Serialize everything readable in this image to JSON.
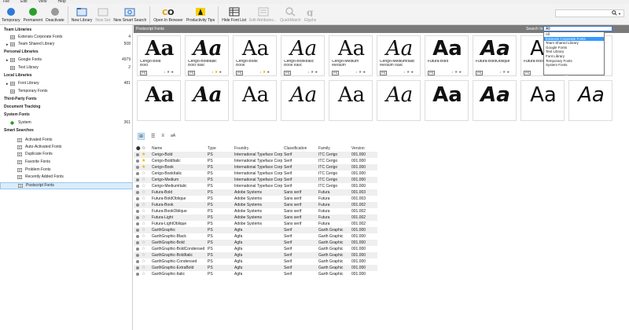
{
  "menu": [
    "File",
    "Edit",
    "View",
    "Help"
  ],
  "toolbar": {
    "buttons": [
      {
        "label": "Temporary",
        "icon": "temporary-icon",
        "color": "#2f7ad9",
        "enabled": true
      },
      {
        "label": "Permanent",
        "icon": "permanent-icon",
        "color": "#2aa02a",
        "enabled": true
      },
      {
        "label": "Deactivate",
        "icon": "deactivate-icon",
        "color": "#9a9a9a",
        "enabled": true
      },
      {
        "label": "New Library",
        "icon": "new-library-icon",
        "color": "#2f6fbf",
        "enabled": true
      },
      {
        "label": "New Set",
        "icon": "new-set-icon",
        "color": "#bbbbbb",
        "enabled": false
      },
      {
        "label": "New Smart Search",
        "icon": "new-smart-search-icon",
        "color": "#3070c0",
        "enabled": true
      },
      {
        "label": "Open In Browser",
        "icon": "open-in-browser-icon",
        "color": "#222222",
        "enabled": true
      },
      {
        "label": "Productivity Tips",
        "icon": "productivity-tips-icon",
        "color": "#222222",
        "enabled": true
      },
      {
        "label": "Hide Font List",
        "icon": "hide-font-list-icon",
        "color": "#333333",
        "enabled": true
      },
      {
        "label": "Edit Attributes...",
        "icon": "edit-attributes-icon",
        "color": "#bbbbbb",
        "enabled": false
      },
      {
        "label": "QuickMatch",
        "icon": "quickmatch-icon",
        "color": "#bbbbbb",
        "enabled": false
      },
      {
        "label": "Glyphs",
        "icon": "glyphs-icon",
        "color": "#bbbbbb",
        "enabled": false
      }
    ],
    "search_icon": "search-icon"
  },
  "sidebar": {
    "rows": [
      {
        "type": "header",
        "label": "Team Libraries"
      },
      {
        "type": "item",
        "label": "Extensis Corporate Fonts",
        "count": "4",
        "icon": "grid",
        "indent": 1
      },
      {
        "type": "item",
        "label": "Team Shared Library",
        "count": "508",
        "icon": "grid",
        "indent": 1,
        "expander": true
      },
      {
        "type": "header",
        "label": "Personal Libraries"
      },
      {
        "type": "item",
        "label": "Google Fonts",
        "count": "4979",
        "icon": "grid",
        "indent": 1,
        "expander": true
      },
      {
        "type": "item",
        "label": "Test Library",
        "count": "2",
        "icon": "grid",
        "indent": 1
      },
      {
        "type": "header",
        "label": "Local Libraries"
      },
      {
        "type": "item",
        "label": "Font Library",
        "count": "481",
        "icon": "grid",
        "indent": 1,
        "expander": true
      },
      {
        "type": "item",
        "label": "Temporary Fonts",
        "count": "",
        "icon": "grid",
        "indent": 1
      },
      {
        "type": "header",
        "label": "Third-Party Fonts"
      },
      {
        "type": "header",
        "label": "Document Tracking"
      },
      {
        "type": "header",
        "label": "System Fonts"
      },
      {
        "type": "item",
        "label": "System",
        "count": "361",
        "icon": "green",
        "indent": 1
      },
      {
        "type": "header",
        "label": "Smart Searches"
      },
      {
        "type": "item",
        "label": "Activated Fonts",
        "count": "",
        "icon": "search",
        "indent": 2
      },
      {
        "type": "item",
        "label": "Auto-Activated Fonts",
        "count": "",
        "icon": "search",
        "indent": 2
      },
      {
        "type": "item",
        "label": "Duplicate Fonts",
        "count": "",
        "icon": "search",
        "indent": 2
      },
      {
        "type": "item",
        "label": "Favorite Fonts",
        "count": "",
        "icon": "search",
        "indent": 2
      },
      {
        "type": "item",
        "label": "Problem Fonts",
        "count": "",
        "icon": "search",
        "indent": 2
      },
      {
        "type": "item",
        "label": "Recently Added Fonts",
        "count": "",
        "icon": "search",
        "indent": 2
      },
      {
        "type": "item",
        "label": "Postscript Fonts",
        "count": "",
        "icon": "search",
        "indent": 2,
        "selected": true
      }
    ]
  },
  "panel": {
    "title": "Postscript Fonts",
    "search_in_label": "Search In:",
    "dropdown_value": "All",
    "dropdown_options": [
      "All",
      "Extensis Corporate Fonts",
      "Team Shared Library",
      "Google Fonts",
      "Test Library",
      "Font Library",
      "Temporary Fonts",
      "System Fonts"
    ],
    "dropdown_highlight": 1
  },
  "tiles": [
    {
      "sample": "Aa",
      "name": "Cerigo-Bold",
      "style": "Bold",
      "weight": "bold",
      "italic": false,
      "family": "serif",
      "star": false
    },
    {
      "sample": "Aa",
      "name": "Cerigo-BoldItalic",
      "style": "Bold Italic",
      "weight": "bold",
      "italic": true,
      "family": "serif",
      "star": true
    },
    {
      "sample": "Aa",
      "name": "Cerigo-Book",
      "style": "Book",
      "weight": "normal",
      "italic": false,
      "family": "serif",
      "star": true
    },
    {
      "sample": "Aa",
      "name": "Cerigo-BookItalic",
      "style": "Book Italic",
      "weight": "normal",
      "italic": true,
      "family": "serif",
      "star": false
    },
    {
      "sample": "Aa",
      "name": "Cerigo-Medium",
      "style": "Medium",
      "weight": "500",
      "italic": false,
      "family": "serif",
      "star": false
    },
    {
      "sample": "Aa",
      "name": "Cerigo-MediumItalic",
      "style": "Medium Italic",
      "weight": "500",
      "italic": true,
      "family": "serif",
      "star": false
    },
    {
      "sample": "Aa",
      "name": "Futura-Bold",
      "style": "",
      "weight": "bold",
      "italic": false,
      "family": "sans",
      "star": false
    },
    {
      "sample": "Aa",
      "name": "Futura-BoldOblique",
      "style": "",
      "weight": "bold",
      "italic": true,
      "family": "sans",
      "star": false
    },
    {
      "sample": "Aa",
      "name": "Futura-Book",
      "style": "",
      "weight": "normal",
      "italic": false,
      "family": "sans",
      "star": false
    },
    {
      "sample": "Aa",
      "name": "Futura-BookObl",
      "style": "",
      "weight": "normal",
      "italic": true,
      "family": "sans",
      "star": false
    }
  ],
  "tiles_row2": [
    "Aa",
    "Aa",
    "Aa",
    "Aa",
    "Aa",
    "Aa",
    "Aa",
    "Aa",
    "Aa",
    "Aa"
  ],
  "table": {
    "headers": {
      "name": "Name",
      "type": "Type",
      "foundry": "Foundry",
      "classification": "Classification",
      "family": "Family",
      "version": "Version"
    },
    "rows": [
      {
        "name": "Cerigo-Bold",
        "type": "PS",
        "foundry": "International Typeface Corp",
        "classification": "Serif",
        "family": "ITC Cerigo",
        "version": "001.000",
        "star": true
      },
      {
        "name": "Cerigo-BoldItalic",
        "type": "PS",
        "foundry": "International Typeface Corp",
        "classification": "Serif",
        "family": "ITC Cerigo",
        "version": "001.000",
        "star": true
      },
      {
        "name": "Cerigo-Book",
        "type": "PS",
        "foundry": "International Typeface Corp",
        "classification": "Serif",
        "family": "ITC Cerigo",
        "version": "001.000",
        "star": true
      },
      {
        "name": "Cerigo-BookItalic",
        "type": "PS",
        "foundry": "International Typeface Corp",
        "classification": "Serif",
        "family": "ITC Cerigo",
        "version": "001.000",
        "star": false
      },
      {
        "name": "Cerigo-Medium",
        "type": "PS",
        "foundry": "International Typeface Corp",
        "classification": "Serif",
        "family": "ITC Cerigo",
        "version": "001.000",
        "star": false
      },
      {
        "name": "Cerigo-MediumItalic",
        "type": "PS",
        "foundry": "International Typeface Corp",
        "classification": "Serif",
        "family": "ITC Cerigo",
        "version": "001.000",
        "star": false
      },
      {
        "name": "Futura-Bold",
        "type": "PS",
        "foundry": "Adobe Systems",
        "classification": "Sans serif",
        "family": "Futura",
        "version": "001.003",
        "star": false
      },
      {
        "name": "Futura-BoldOblique",
        "type": "PS",
        "foundry": "Adobe Systems",
        "classification": "Sans serif",
        "family": "Futura",
        "version": "001.003",
        "star": false
      },
      {
        "name": "Futura-Book",
        "type": "PS",
        "foundry": "Adobe Systems",
        "classification": "Sans serif",
        "family": "Futura",
        "version": "001.002",
        "star": false
      },
      {
        "name": "Futura-BookOblique",
        "type": "PS",
        "foundry": "Adobe Systems",
        "classification": "Sans serif",
        "family": "Futura",
        "version": "001.002",
        "star": false
      },
      {
        "name": "Futura-Light",
        "type": "PS",
        "foundry": "Adobe Systems",
        "classification": "Sans serif",
        "family": "Futura",
        "version": "001.002",
        "star": false
      },
      {
        "name": "Futura-LightOblique",
        "type": "PS",
        "foundry": "Adobe Systems",
        "classification": "Sans serif",
        "family": "Futura",
        "version": "001.002",
        "star": false
      },
      {
        "name": "GarthGraphic",
        "type": "PS",
        "foundry": "Agfa",
        "classification": "Serif",
        "family": "Garth Graphic",
        "version": "001.000",
        "star": false
      },
      {
        "name": "GarthGraphic-Black",
        "type": "PS",
        "foundry": "Agfa",
        "classification": "Serif",
        "family": "Garth Graphic",
        "version": "001.000",
        "star": false
      },
      {
        "name": "GarthGraphic-Bold",
        "type": "PS",
        "foundry": "Agfa",
        "classification": "Serif",
        "family": "Garth Graphic",
        "version": "001.000",
        "star": false
      },
      {
        "name": "GarthGraphic-BoldCondensed",
        "type": "PS",
        "foundry": "Agfa",
        "classification": "Serif",
        "family": "Garth Graphic",
        "version": "001.000",
        "star": false
      },
      {
        "name": "GarthGraphic-BoldItalic",
        "type": "PS",
        "foundry": "Agfa",
        "classification": "Serif",
        "family": "Garth Graphic",
        "version": "001.000",
        "star": false
      },
      {
        "name": "GarthGraphic-Condensed",
        "type": "PS",
        "foundry": "Agfa",
        "classification": "Serif",
        "family": "Garth Graphic",
        "version": "001.000",
        "star": false
      },
      {
        "name": "GarthGraphic-ExtraBold",
        "type": "PS",
        "foundry": "Agfa",
        "classification": "Serif",
        "family": "Garth Graphic",
        "version": "001.000",
        "star": false
      },
      {
        "name": "GarthGraphic-Italic",
        "type": "PS",
        "foundry": "Agfa",
        "classification": "Serif",
        "family": "Garth Graphic",
        "version": "001.000",
        "star": false
      }
    ]
  },
  "colors": {
    "accent": "#3399ff",
    "titlebar": "#7a7a7a",
    "star_on": "#f0b400"
  }
}
